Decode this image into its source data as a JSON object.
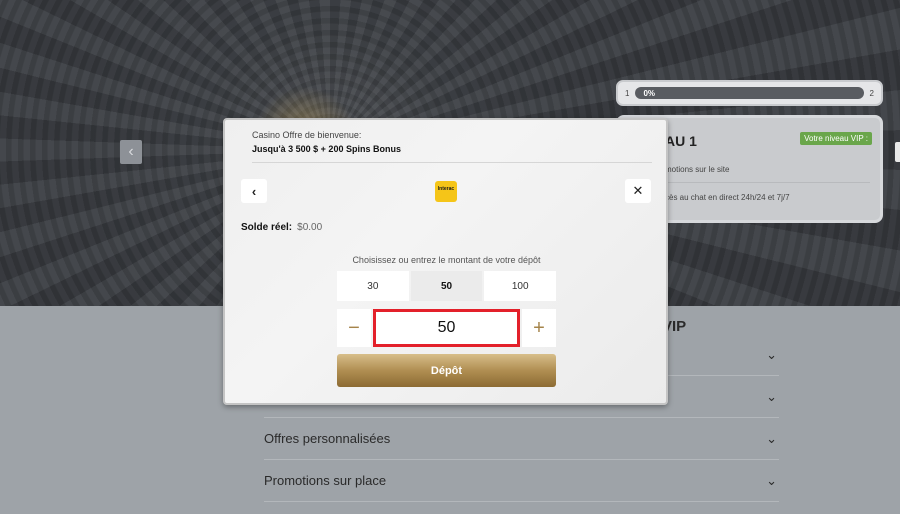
{
  "hero": {
    "prev_icon": "chevron-left-icon"
  },
  "vip": {
    "progress": {
      "start": "1",
      "end": "2",
      "percent_label": "0%",
      "percent": 0
    },
    "level_title": "AU 1",
    "badge": "Votre niveau VIP :",
    "perk1": "motions sur le site",
    "perk2": "cès au chat en direct 24h/24 et 7j/7",
    "section_title": "VIP"
  },
  "accordion": [
    {
      "label": ""
    },
    {
      "label": ""
    },
    {
      "label": "Offres personnalisées"
    },
    {
      "label": "Promotions sur place"
    }
  ],
  "modal": {
    "offer_label": "Casino Offre de bienvenue:",
    "offer_value": "Jusqu'à 3 500 $ + 200 Spins Bonus",
    "back_icon": "chevron-left-icon",
    "close_icon": "close-icon",
    "logo_text": "Interac",
    "balance_label": "Solde réel:",
    "balance_value": "$0.00",
    "prompt": "Choisissez ou entrez le montant de votre dépôt",
    "presets": [
      "30",
      "50",
      "100"
    ],
    "selected_preset": "50",
    "amount": "50",
    "deposit_label": "Dépôt"
  },
  "colors": {
    "accent_gold": "#b08e52",
    "highlight_red": "#e3202a",
    "badge_green": "#6aa64b"
  }
}
